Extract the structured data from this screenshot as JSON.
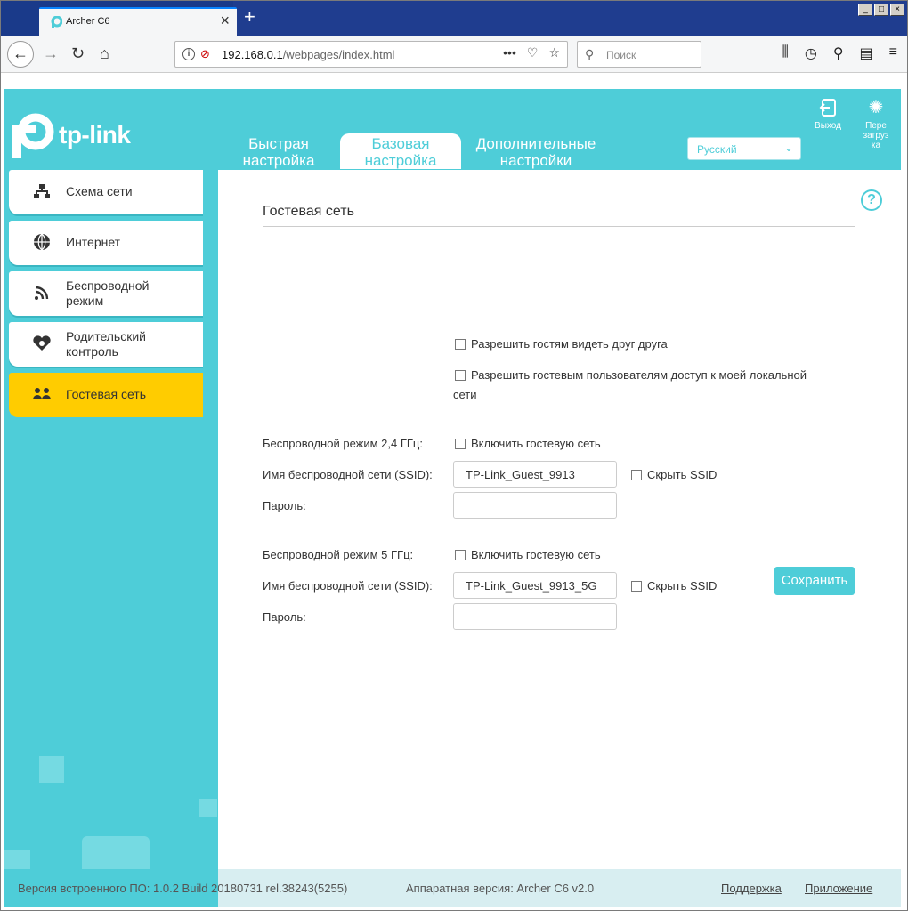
{
  "browser": {
    "tab_title": "Archer C6",
    "url_host": "192.168.0.1",
    "url_path": "/webpages/index.html",
    "search_placeholder": "Поиск",
    "url_more": "•••"
  },
  "header": {
    "logo_text": "tp-link",
    "tabs": [
      {
        "line1": "Быстрая",
        "line2": "настройка"
      },
      {
        "line1": "Базовая",
        "line2": "настройка"
      },
      {
        "line1": "Дополнительные",
        "line2": "настройки"
      }
    ],
    "language": "Русский",
    "logout_label": "Выход",
    "reboot_line1": "Пере",
    "reboot_line2": "загруз",
    "reboot_line3": "ка"
  },
  "sidebar": {
    "items": [
      {
        "label": "Схема сети",
        "icon": "network-map-icon"
      },
      {
        "label": "Интернет",
        "icon": "globe-icon"
      },
      {
        "label_l1": "Беспроводной",
        "label_l2": "режим",
        "icon": "wireless-icon"
      },
      {
        "label_l1": "Родительский",
        "label_l2": "контроль",
        "icon": "parental-control-icon"
      },
      {
        "label": "Гостевая сеть",
        "icon": "guest-network-icon"
      }
    ]
  },
  "guest": {
    "title": "Гостевая сеть",
    "allow_see_each_other": "Разрешить гостям видеть друг друга",
    "allow_local_l1": "Разрешить гостевым пользователям доступ к моей локальной",
    "allow_local_l2": "сети",
    "band24": {
      "label": "Беспроводной режим 2,4 ГГц:",
      "enable": "Включить гостевую сеть",
      "ssid_label": "Имя беспроводной сети (SSID):",
      "ssid_value": "TP-Link_Guest_9913",
      "hide_ssid": "Скрыть SSID",
      "password_label": "Пароль:",
      "password_value": ""
    },
    "band5": {
      "label": "Беспроводной режим 5 ГГц:",
      "enable": "Включить гостевую сеть",
      "ssid_label": "Имя беспроводной сети (SSID):",
      "ssid_value": "TP-Link_Guest_9913_5G",
      "hide_ssid": "Скрыть SSID",
      "password_label": "Пароль:",
      "password_value": ""
    },
    "save": "Сохранить"
  },
  "footer": {
    "firmware": "Версия встроенного ПО: 1.0.2 Build 20180731 rel.38243(5255)",
    "hardware": "Аппаратная версия: Archer C6 v2.0",
    "support": "Поддержка",
    "app": "Приложение"
  }
}
